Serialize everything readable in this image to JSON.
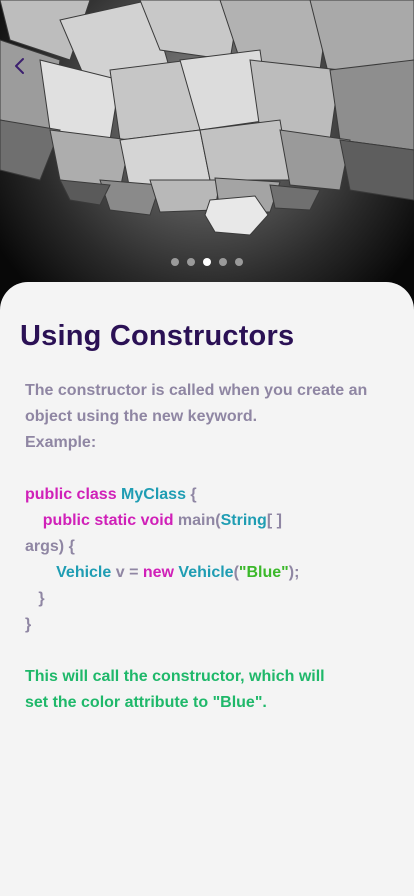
{
  "hero": {
    "image": "abstract-gray-cubes",
    "back_icon": "chevron-left-icon",
    "pagination": {
      "total": 5,
      "active_index": 2
    }
  },
  "lesson": {
    "title": "Using Constructors",
    "description_line1": "The constructor is called when you create an",
    "description_line2": "object using the new keyword.",
    "example_label": "Example:",
    "code": {
      "line1": {
        "kw1": "public class ",
        "cls": "MyClass",
        "rest": " {"
      },
      "line2": {
        "indent": "    ",
        "kw": "public static void ",
        "plain1": "main(",
        "cls": "String",
        "plain2": "[ ]"
      },
      "line3": {
        "plain": "args) {"
      },
      "line4": {
        "indent": "       ",
        "cls1": "Vehicle",
        "plain1": " v = ",
        "kw": "new ",
        "cls2": "Vehicle",
        "plain2": "(",
        "str": "\"Blue\"",
        "plain3": ");"
      },
      "line5": {
        "plain": "   }"
      },
      "line6": {
        "plain": "}"
      }
    },
    "note_line1": "This will call the constructor, which will",
    "note_line2": "set the color attribute to \"Blue\"."
  },
  "colors": {
    "title": "#2b1155",
    "body": "#8f86a3",
    "keyword": "#d020b8",
    "class_name": "#1f9db3",
    "string": "#3bb82a",
    "note": "#1fb86a",
    "card_bg": "#f4f4f4"
  }
}
